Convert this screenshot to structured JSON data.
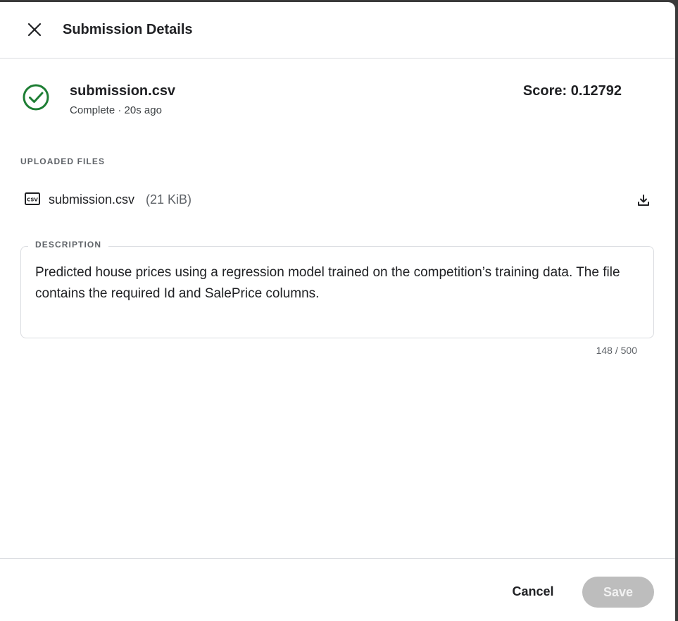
{
  "header": {
    "title": "Submission Details",
    "close_icon": "close-icon"
  },
  "submission": {
    "file_name": "submission.csv",
    "status": "Complete · 20s ago",
    "status_icon": "check-circle-icon",
    "status_color": "#1e7e34",
    "score": "Score: 0.12792"
  },
  "uploaded_files": {
    "label": "UPLOADED FILES",
    "items": [
      {
        "name": "submission.csv",
        "size": "(21 KiB)",
        "icon": "csv-file-icon",
        "action_icon": "download-icon"
      }
    ]
  },
  "description": {
    "label": "DESCRIPTION",
    "value": "Predicted house prices using a regression model trained on the competition’s training data. The file contains the required Id and SalePrice columns.",
    "char_count": "148 / 500"
  },
  "footer": {
    "cancel_label": "Cancel",
    "save_label": "Save",
    "save_disabled_color": "#bdbdbd"
  }
}
